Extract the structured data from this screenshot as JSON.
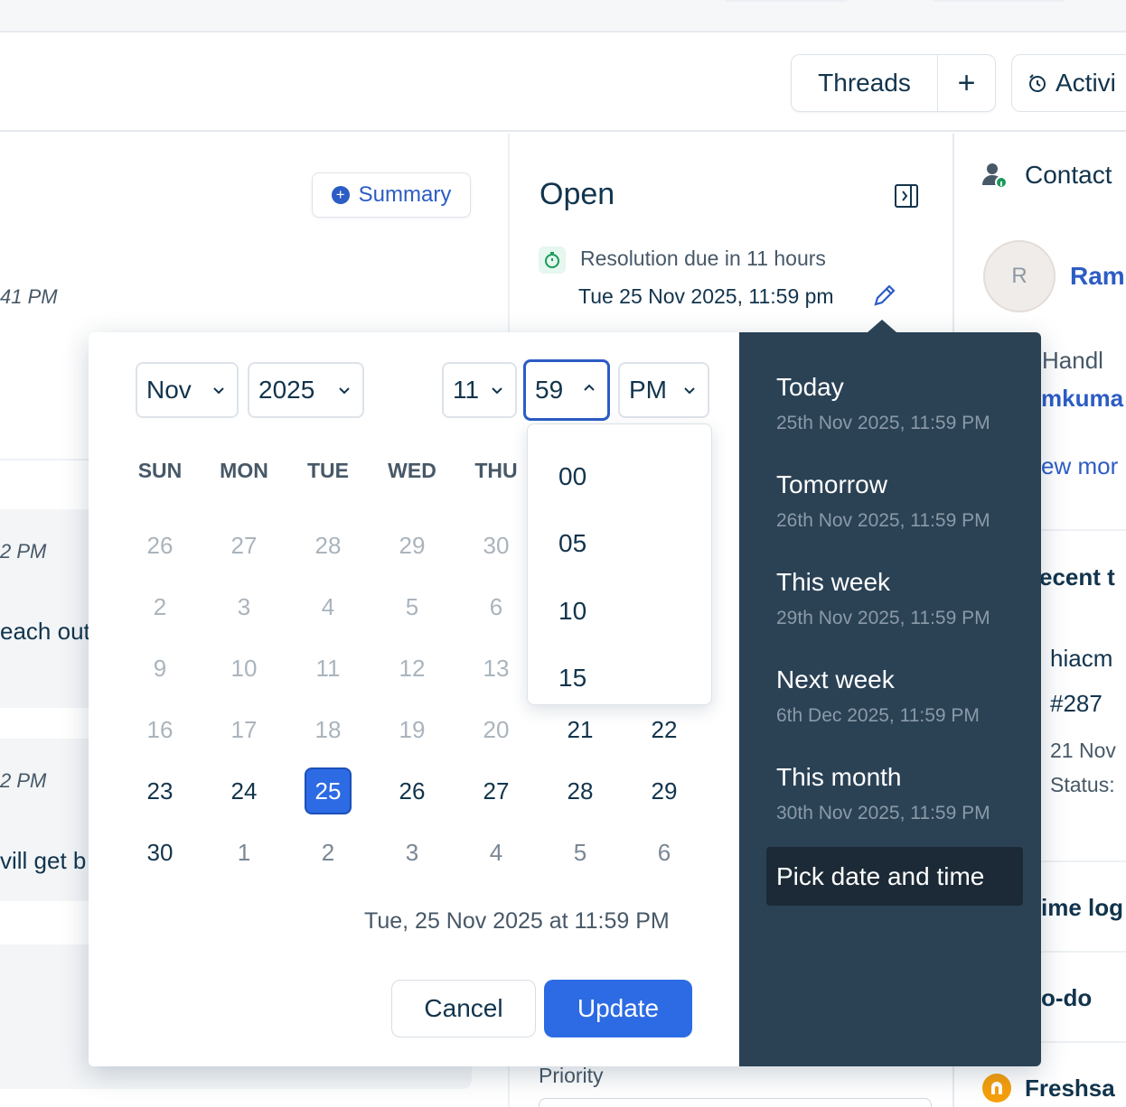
{
  "toolbar": {
    "threads_label": "Threads",
    "add_label": "+",
    "activity_label": "Activi"
  },
  "left": {
    "summary_label": "Summary",
    "timestamps": [
      "41 PM",
      "2 PM",
      "2 PM"
    ],
    "snippets": [
      "each out",
      "vill get b"
    ]
  },
  "status": {
    "title": "Open",
    "due_label": "Resolution due in 11 hours",
    "due_date": "Tue 25 Nov 2025, 11:59 pm",
    "priority_label": "Priority"
  },
  "contact": {
    "heading": "Contact",
    "avatar_initial": "R",
    "name": "Raml",
    "handle_label": "l Handl",
    "handle_value": "mkuma",
    "view_more": "ew mor",
    "recent_heading": "ecent t",
    "recent_ticket_title": "hiacm",
    "recent_ticket_id": "#287",
    "recent_ticket_date": "21 Nov",
    "recent_ticket_status": "Status:",
    "time_log": "ime log",
    "todo": "o-do",
    "freshsales": "Freshsa"
  },
  "picker": {
    "month": "Nov",
    "year": "2025",
    "hour": "11",
    "minute": "59",
    "ampm": "PM",
    "weekdays": [
      "SUN",
      "MON",
      "TUE",
      "WED",
      "THU"
    ],
    "rows": [
      [
        "26",
        "27",
        "28",
        "29",
        "30"
      ],
      [
        "2",
        "3",
        "4",
        "5",
        "6"
      ],
      [
        "9",
        "10",
        "11",
        "12",
        "13"
      ],
      [
        "16",
        "17",
        "18",
        "19",
        "20",
        "21",
        "22"
      ],
      [
        "23",
        "24",
        "25",
        "26",
        "27",
        "28",
        "29"
      ],
      [
        "30",
        "1",
        "2",
        "3",
        "4",
        "5",
        "6"
      ]
    ],
    "selected_day": "25",
    "minute_options": [
      "00",
      "05",
      "10",
      "15"
    ],
    "preview": "Tue, 25 Nov 2025 at 11:59 PM",
    "cancel_label": "Cancel",
    "update_label": "Update"
  },
  "quick": {
    "items": [
      {
        "title": "Today",
        "sub": "25th Nov 2025, 11:59 PM"
      },
      {
        "title": "Tomorrow",
        "sub": "26th Nov 2025, 11:59 PM"
      },
      {
        "title": "This week",
        "sub": "29th Nov 2025, 11:59 PM"
      },
      {
        "title": "Next week",
        "sub": "6th Dec 2025, 11:59 PM"
      },
      {
        "title": "This month",
        "sub": "30th Nov 2025, 11:59 PM"
      }
    ],
    "pick_label": "Pick date and time"
  },
  "colors": {
    "accent": "#2c6be4",
    "link": "#2c5cc5",
    "dark_panel": "#2b4255",
    "text": "#12344d"
  }
}
